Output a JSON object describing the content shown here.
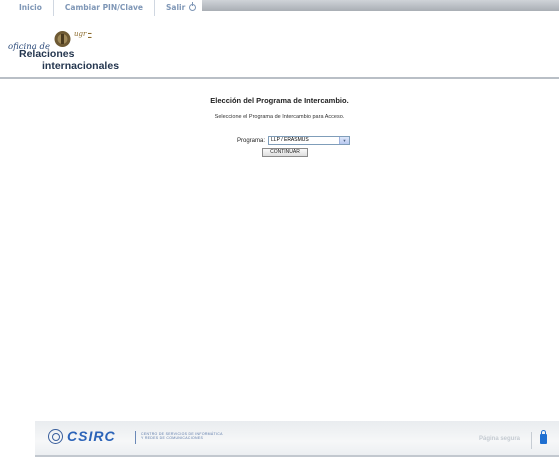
{
  "nav": {
    "items": [
      {
        "label": "Inicio"
      },
      {
        "label": "Cambiar PIN/Clave"
      },
      {
        "label": "Salir"
      }
    ],
    "logout_icon": "power-icon"
  },
  "header": {
    "office_label": "oficina de",
    "title_line1": "Relaciones",
    "title_line2": "internacionales",
    "university_mark": "ugr"
  },
  "main": {
    "title": "Elección del Programa de Intercambio.",
    "description": "Seleccione el Programa de Intercambio para Acceso.",
    "program_label": "Programa:",
    "program_value": "LLP / ERASMUS",
    "continue_label": "CONTINUAR"
  },
  "footer": {
    "brand": "CSIRC",
    "brand_desc_line1": "Centro de Servicios de Informática",
    "brand_desc_line2": "y Redes de Comunicaciones",
    "secure_label": "Página segura"
  },
  "colors": {
    "nav_text": "#7e96b6",
    "title_text": "#24364f",
    "brand_blue": "#2b63b8",
    "lock_blue": "#1f6fd1"
  }
}
